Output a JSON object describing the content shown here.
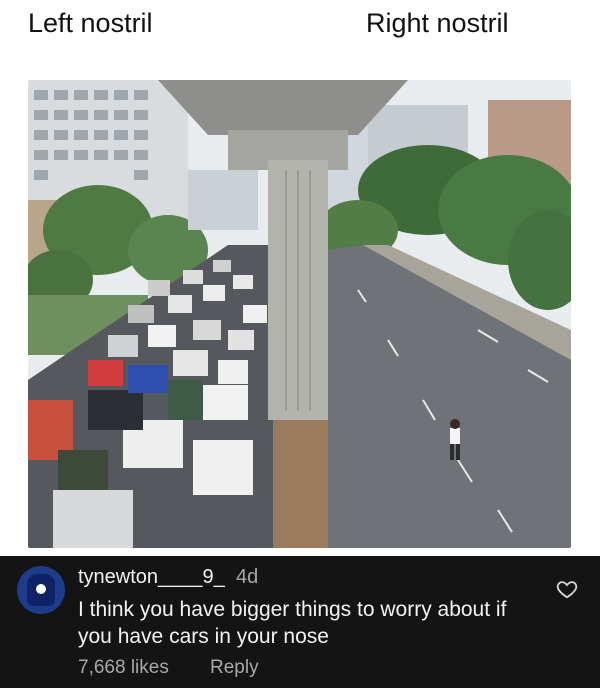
{
  "meme": {
    "left_caption": "Left nostril",
    "right_caption": "Right nostril"
  },
  "comment": {
    "username": "tynewton____9_",
    "time": "4d",
    "text": "I think you have bigger things to worry about if you have cars in your nose",
    "likes": "7,668 likes",
    "reply_label": "Reply"
  },
  "icons": {
    "like": "heart-icon"
  },
  "colors": {
    "comment_bg": "#141414",
    "comment_text": "#f2f2f2",
    "muted_text": "#a8a8a8"
  }
}
